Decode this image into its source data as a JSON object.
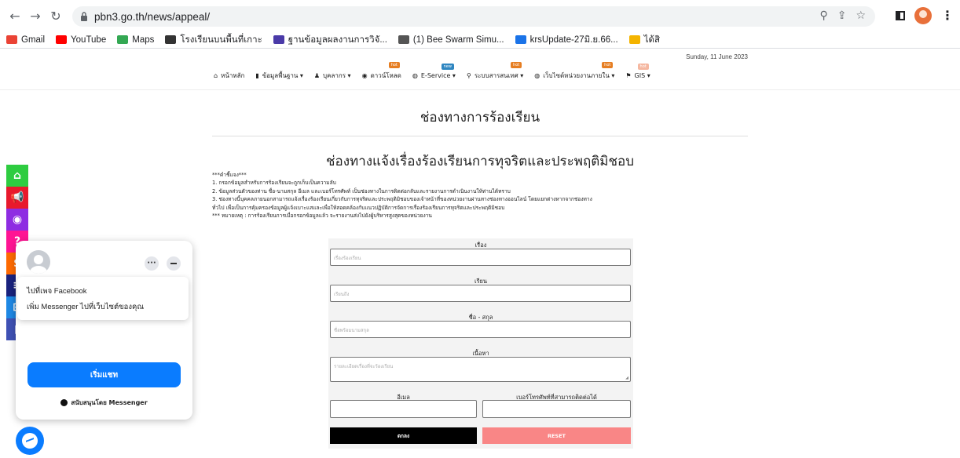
{
  "browser": {
    "url": "pbn3.go.th/news/appeal/",
    "bookmarks": [
      {
        "label": "Gmail",
        "icon": "gmail-icon",
        "color": "#ea4335"
      },
      {
        "label": "YouTube",
        "icon": "youtube-icon",
        "color": "#ff0000"
      },
      {
        "label": "Maps",
        "icon": "maps-icon",
        "color": "#34a853"
      },
      {
        "label": "โรงเรียนบนพื้นที่เกาะ",
        "icon": "globe-icon",
        "color": "#333333"
      },
      {
        "label": "ฐานข้อมูลผลงานการวิจั...",
        "icon": "database-icon",
        "color": "#4a3aa8"
      },
      {
        "label": "(1) Bee Swarm Simu...",
        "icon": "bee-swarm-icon",
        "color": "#555555"
      },
      {
        "label": "krsUpdate-27มิ.ย.66...",
        "icon": "drive-icon",
        "color": "#1a73e8"
      },
      {
        "label": "ได้สิ",
        "icon": "trophy-icon",
        "color": "#f4b400"
      }
    ]
  },
  "header": {
    "date": "Sunday, 11 June 2023",
    "nav": [
      {
        "label": "หน้าหลัก",
        "icon": "home-icon",
        "badge": ""
      },
      {
        "label": "ข้อมูลพื้นฐาน ▾",
        "icon": "book-icon",
        "badge": ""
      },
      {
        "label": "บุคลากร ▾",
        "icon": "person-icon",
        "badge": ""
      },
      {
        "label": "ดาวน์โหลด",
        "icon": "download-icon",
        "badge": "hot"
      },
      {
        "label": "E-Service ▾",
        "icon": "globe-icon",
        "badge": "new"
      },
      {
        "label": "ระบบสารสนเทศ ▾",
        "icon": "network-icon",
        "badge": "hot"
      },
      {
        "label": "เว็บไซต์หน่วยงานภายใน ▾",
        "icon": "link-icon",
        "badge": "hot"
      },
      {
        "label": "GIS ▾",
        "icon": "map-pin-icon",
        "badge": "hot"
      }
    ]
  },
  "main": {
    "title": "ช่องทางการร้องเรียน",
    "subtitle": "ช่องทางแจ้งเรื่องร้องเรียนการทุจริตและประพฤติมิชอบ",
    "notes": [
      "***คำชี้แจง***",
      "1. กรอกข้อมูลสำหรับการร้องเรียนจะถูกเก็บเป็นความลับ",
      "2. ข้อมูลส่วนตัวของท่าน ชื่อ-นามสกุล อีเมล และเบอร์โทรศัพท์ เป็นช่องทางในการติดต่อกลับและรายงานการดำเนินงานให้ท่านได้ทราบ",
      "3. ช่องทางนี้บุคคลภายนอกสามารถแจ้งเรื่องร้องเรียนเกี่ยวกับการทุจริตและประพฤติมิชอบของเจ้าหน้าที่ของหน่วยงานผ่านทางช่องทางออนไลน์ โดยแยกต่างหากจากช่องทาง",
      "ทั่วไป เพื่อเป็นการคุ้มครองข้อมูลผู้แจ้งเบาะแสและเพื่อให้สอดคล้องกับแนวปฏิบัติการจัดการเรื่องร้องเรียนการทุจริตและประพฤติมิชอบ",
      "*** หมายเหตุ : การร้องเรียนการเมื่อกรอกข้อมูลแล้ว จะรายงานส่งไปยังผู้บริหารสูงสุดของหน่วยงาน"
    ]
  },
  "form": {
    "subject_label": "เรื่อง",
    "subject_placeholder": "เรื่องร้องเรียน",
    "to_label": "เรียน",
    "to_placeholder": "เรียนถึง",
    "name_label": "ชื่อ - สกุล",
    "name_placeholder": "ชื่อพร้อมนามสกุล",
    "content_label": "เนื้อหา",
    "content_placeholder": "รายละเอียดเรื่องที่จะร้องเรียน",
    "email_label": "อีเมล",
    "phone_label": "เบอร์โทรศัพท์ที่สามารถติดต่อได้",
    "submit_label": "ตกลง",
    "reset_label": "RESET"
  },
  "social": [
    {
      "icon": "home-icon",
      "color": "#2ecc40",
      "glyph": "⌂"
    },
    {
      "icon": "megaphone-icon",
      "color": "#e8192c",
      "glyph": "📢"
    },
    {
      "icon": "eye-icon",
      "color": "#8e2de2",
      "glyph": "◉"
    },
    {
      "icon": "question-icon",
      "color": "#ff1493",
      "glyph": "?"
    },
    {
      "icon": "dollar-icon",
      "color": "#ff6a00",
      "glyph": "$"
    },
    {
      "icon": "document-icon",
      "color": "#1a237e",
      "glyph": "≡"
    },
    {
      "icon": "sitemap-icon",
      "color": "#1e88e5",
      "glyph": "⊞"
    },
    {
      "icon": "chart-icon",
      "color": "#3f51b5",
      "glyph": "▮"
    }
  ],
  "messenger": {
    "menu_item_1": "ไปที่เพจ Facebook",
    "menu_item_2": "เพิ่ม Messenger ไปที่เว็บไซต์ของคุณ",
    "start_chat": "เริ่มแชท",
    "powered_by": "สนับสนุนโดย Messenger",
    "accent": "#0a7cff"
  }
}
